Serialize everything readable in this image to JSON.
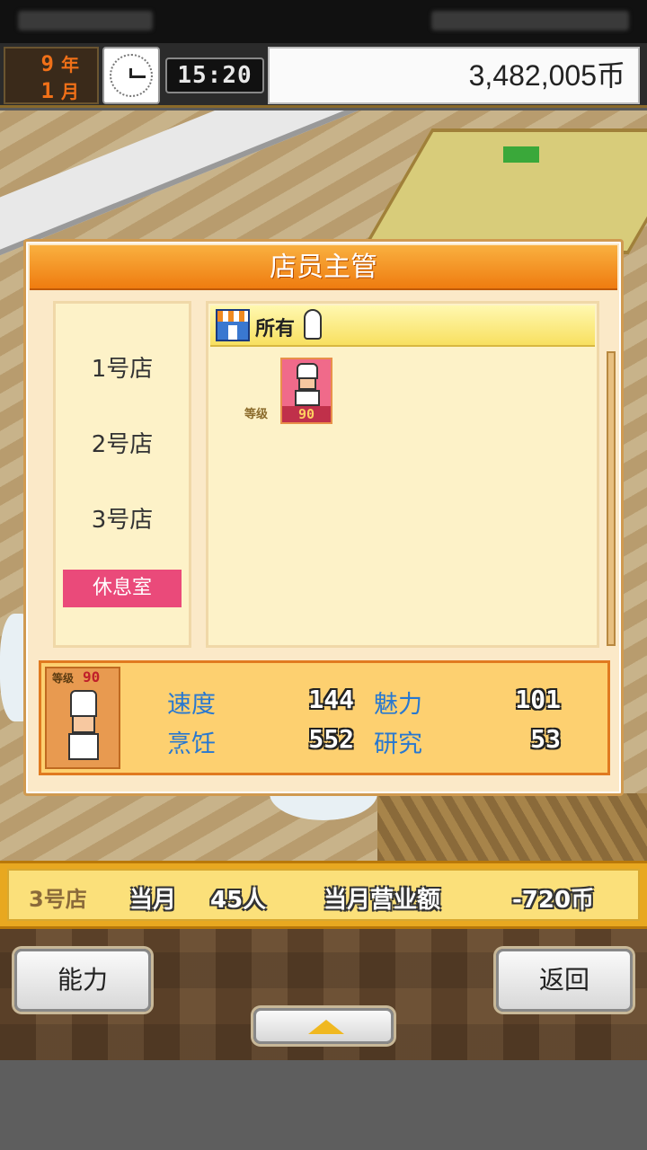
{
  "hud": {
    "year_num": "9",
    "year_unit": "年",
    "month_num": "1",
    "month_unit": "月",
    "time": "15:20",
    "money": "3,482,005币"
  },
  "dialog": {
    "title": "店员主管",
    "stores": [
      "1号店",
      "2号店",
      "3号店"
    ],
    "rest_room": "休息室",
    "filter_label": "所有",
    "level_label": "等级",
    "staff": [
      {
        "level": "90"
      }
    ],
    "detail": {
      "level_label": "等级",
      "level": "90",
      "stats": {
        "speed_label": "速度",
        "speed": "144",
        "charm_label": "魅力",
        "charm": "101",
        "cooking_label": "烹饪",
        "cooking": "552",
        "research_label": "研究",
        "research": "53"
      }
    }
  },
  "infobar": {
    "store": "3号店",
    "month_label": "当月",
    "visitors": "45人",
    "sales_label": "当月营业额",
    "sales": "-720币"
  },
  "controls": {
    "ability_label": "能力",
    "back_label": "返回"
  },
  "colors": {
    "title_orange": "#ef7c10",
    "rest_pink": "#ea4a7a",
    "stat_blue": "#2878d0"
  }
}
